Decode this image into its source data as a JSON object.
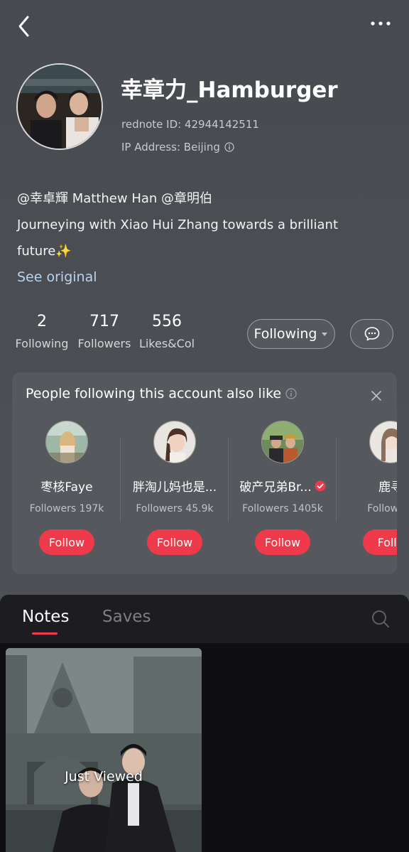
{
  "profile": {
    "username": "幸章力_Hamburger",
    "rednote_id": "rednote ID: 42944142511",
    "ip_address": "IP Address: Beijing",
    "bio_line1": "@幸卓輝 Matthew Han @章明伯",
    "bio_line2": "Journeying with Xiao Hui Zhang towards a brilliant future✨",
    "see_original": "See original"
  },
  "stats": [
    {
      "number": "2",
      "label": "Following"
    },
    {
      "number": "717",
      "label": "Followers"
    },
    {
      "number": "556",
      "label": "Likes&Col"
    }
  ],
  "actions": {
    "following_label": "Following"
  },
  "recommendations": {
    "title": "People following this account also like",
    "items": [
      {
        "name": "枣核Faye",
        "followers": "Followers 197k",
        "follow_label": "Follow",
        "verified": false
      },
      {
        "name": "胖淘儿妈也是...",
        "followers": "Followers 45.9k",
        "follow_label": "Follow",
        "verified": false
      },
      {
        "name": "破产兄弟Br...",
        "followers": "Followers 1405k",
        "follow_label": "Follow",
        "verified": true
      },
      {
        "name": "鹿寻",
        "followers": "Followers",
        "follow_label": "Follo",
        "verified": false
      }
    ]
  },
  "tabs": {
    "notes": "Notes",
    "saves": "Saves"
  },
  "notes": [
    {
      "overlay": "Just Viewed"
    }
  ],
  "colors": {
    "accent": "#ee3a4a",
    "link": "#b9d3ee",
    "verified": "#ee3a4a"
  },
  "icons": [
    "back-icon",
    "more-icon",
    "info-icon",
    "caret-down-icon",
    "message-icon",
    "close-icon",
    "verified-icon",
    "search-icon"
  ]
}
